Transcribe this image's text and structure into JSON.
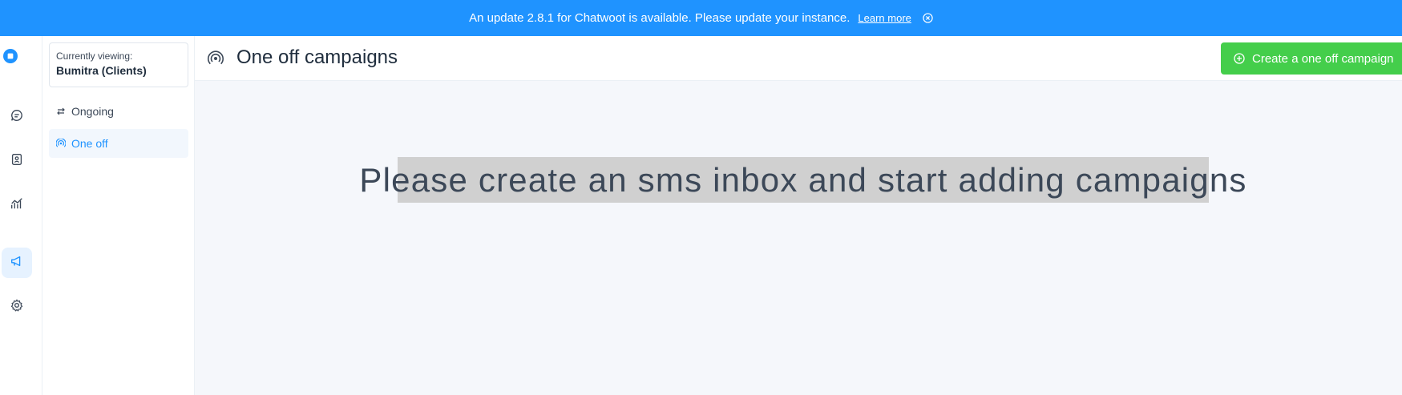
{
  "banner": {
    "message": "An update 2.8.1 for Chatwoot is available. Please update your instance.",
    "learn_more": "Learn more",
    "color": "#1f93ff"
  },
  "rail": {
    "items": [
      {
        "icon": "chat-bubble-icon"
      },
      {
        "icon": "contacts-book-icon"
      },
      {
        "icon": "reports-chart-icon"
      },
      {
        "icon": "megaphone-icon",
        "active": true
      },
      {
        "icon": "gear-icon"
      }
    ]
  },
  "subnav": {
    "context_label": "Currently viewing:",
    "context_value": "Bumitra (Clients)",
    "items": [
      {
        "label": "Ongoing",
        "icon": "arrows-exchange-icon"
      },
      {
        "label": "One off",
        "icon": "broadcast-icon",
        "active": true
      }
    ]
  },
  "header": {
    "title": "One off campaigns",
    "create_button": "Create a one off campaign",
    "accent": "#44ce4b"
  },
  "main": {
    "empty_message": "Please create an sms inbox and start adding campaigns"
  }
}
